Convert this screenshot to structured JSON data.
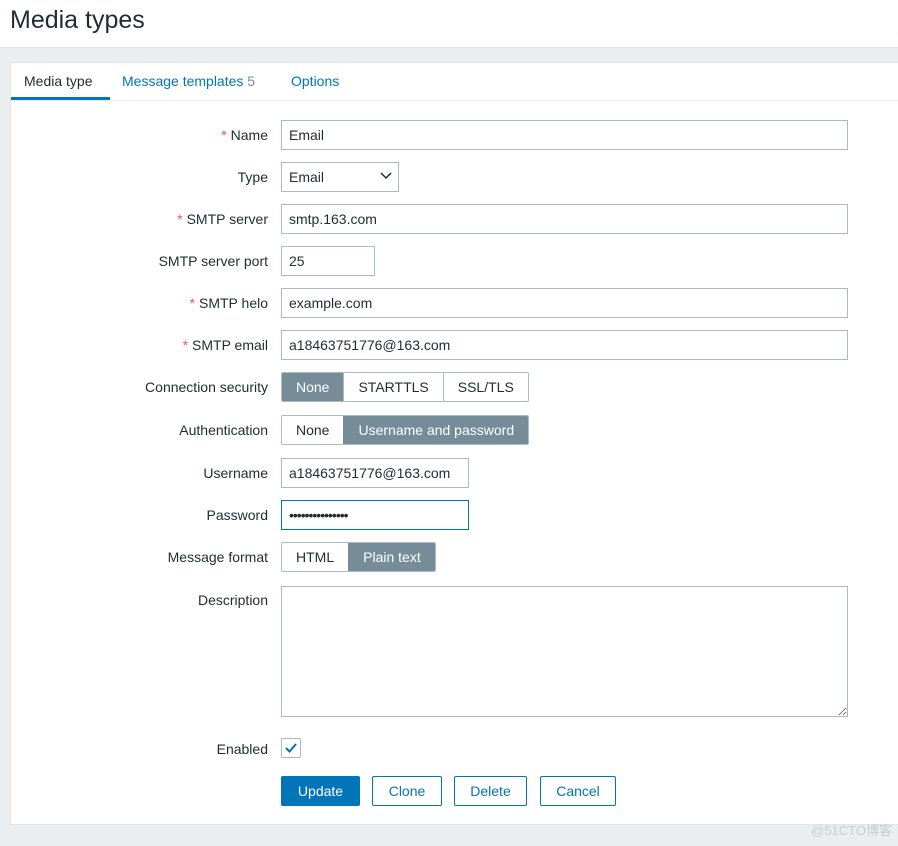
{
  "page_title": "Media types",
  "tabs": [
    {
      "label": "Media type",
      "active": true
    },
    {
      "label": "Message templates",
      "count": "5"
    },
    {
      "label": "Options"
    }
  ],
  "form": {
    "name": {
      "label": "Name",
      "value": "Email"
    },
    "type": {
      "label": "Type",
      "value": "Email"
    },
    "smtp_server": {
      "label": "SMTP server",
      "value": "smtp.163.com"
    },
    "smtp_port": {
      "label": "SMTP server port",
      "value": "25"
    },
    "smtp_helo": {
      "label": "SMTP helo",
      "value": "example.com"
    },
    "smtp_email": {
      "label": "SMTP email",
      "value": "a18463751776@163.com"
    },
    "connection_security": {
      "label": "Connection security",
      "options": [
        "None",
        "STARTTLS",
        "SSL/TLS"
      ],
      "selected": "None"
    },
    "authentication": {
      "label": "Authentication",
      "options": [
        "None",
        "Username and password"
      ],
      "selected": "Username and password"
    },
    "username": {
      "label": "Username",
      "value": "a18463751776@163.com"
    },
    "password": {
      "label": "Password",
      "value": "•••••••••••••••"
    },
    "message_format": {
      "label": "Message format",
      "options": [
        "HTML",
        "Plain text"
      ],
      "selected": "Plain text"
    },
    "description": {
      "label": "Description",
      "value": ""
    },
    "enabled": {
      "label": "Enabled",
      "checked": true
    }
  },
  "buttons": {
    "update": "Update",
    "clone": "Clone",
    "delete": "Delete",
    "cancel": "Cancel"
  },
  "watermark": "@51CTO博客",
  "colors": {
    "accent": "#0275b8",
    "segment_selected": "#768d99",
    "required": "#e45959"
  }
}
